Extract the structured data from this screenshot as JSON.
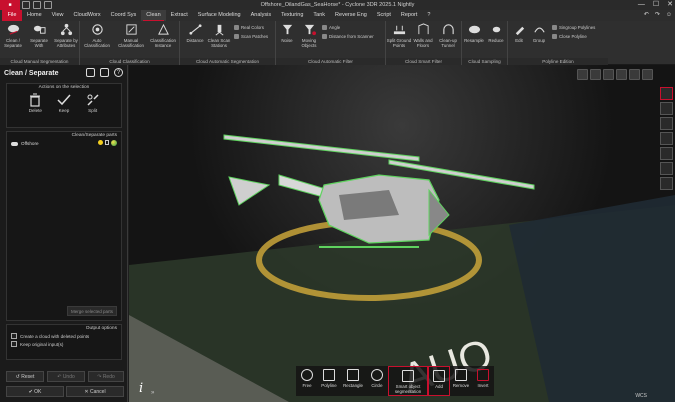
{
  "window": {
    "title": "Offshore_OilandGas_SeaHorse* - Cyclone 3DR 2025.1 Nightly",
    "controls": [
      "—",
      "☐",
      "✕"
    ]
  },
  "menu": {
    "items": [
      "File",
      "Home",
      "View",
      "CloudWorx",
      "Coord Sys",
      "Clean",
      "Extract",
      "Surface Modeling",
      "Analysis",
      "Texturing",
      "Tank",
      "Reverse Eng",
      "Script",
      "Report",
      "?"
    ],
    "active": "Clean"
  },
  "ribbon": {
    "cloud_manual_segmentation": {
      "label": "Cloud Manual Segmentation",
      "clean_separate": "Clean / Separate",
      "separate_with": "Separate With",
      "separate_by_attributes": "Separate by Attributes"
    },
    "cloud_classification": {
      "label": "Cloud Classification",
      "auto_classification": "Auto Classification",
      "manual_classification": "Manual Classification",
      "classification_instance": "Classification Instance"
    },
    "cloud_automatic_segmentation": {
      "label": "Cloud Automatic Segmentation",
      "distance": "Distance",
      "clean_scan_stations": "Clean Scan Stations",
      "real_colors": "Real Colors",
      "scan_patches": "Scan Patches"
    },
    "cloud_automatic_filter": {
      "label": "Cloud Automatic Filter",
      "noise": "Noise",
      "moving_objects": "Moving Objects",
      "angle": "Angle",
      "distance_from_scanner": "Distance from Scanner"
    },
    "cloud_smart_filter": {
      "label": "Cloud Smart Filter",
      "split_ground": "Split Ground Points",
      "walls_floors": "Walls and Floors",
      "clean_up_tunnel": "Clean-up Tunnel"
    },
    "cloud_sampling": {
      "label": "Cloud Sampling",
      "resample": "Resample",
      "reduce": "Reduce"
    },
    "polyline_edition": {
      "label": "Polyline Edition",
      "edit": "Edit",
      "group": "Group",
      "singroup": "Singroup Polylines",
      "close": "Close Polyline"
    }
  },
  "panel": {
    "title": "Clean / Separate",
    "actions_title": "Actions on the selection",
    "actions": [
      "Delete",
      "Keep",
      "Split"
    ],
    "parts_title": "Clean/Separate parts",
    "parts": [
      "Offshore"
    ],
    "merge_button": "Merge selected parts",
    "output_title": "Output options",
    "options": [
      "Create a cloud with deleted points",
      "Keep original input(s)"
    ],
    "reset": "Reset",
    "undo": "Undo",
    "redo": "Redo",
    "ok": "OK",
    "cancel": "Cancel"
  },
  "viewport": {
    "toolbar": [
      "Free",
      "Polyline",
      "Rectangle",
      "Circle",
      "Smart object segmentation",
      "Add",
      "Remove",
      "Invert"
    ],
    "coord_label": "WCS",
    "info": "i",
    "expand": "»"
  },
  "colors": {
    "accent": "#c8102e",
    "highlight": "#5fd35f"
  }
}
